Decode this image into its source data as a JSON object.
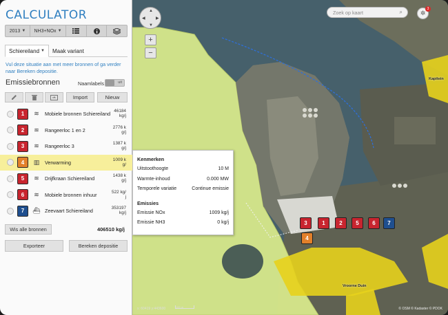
{
  "app": {
    "title": "CALCULATOR"
  },
  "toolbar": {
    "year": "2013",
    "substance": "NH3+NOx",
    "icons": [
      "list-icon",
      "info-icon",
      "layers-icon"
    ]
  },
  "tabs": [
    {
      "label": "Schiereiland",
      "active": true
    },
    {
      "label": "Maak variant",
      "active": false
    }
  ],
  "hint": "Vul deze situatie aan met meer bronnen of ga verder naar Bereken depositie.",
  "emission": {
    "title": "Emissiebronnen",
    "name_labels": "Naamlabels",
    "toggle_state": "uit"
  },
  "actions": {
    "icons": [
      "pencil-icon",
      "trash-icon",
      "copy-icon"
    ],
    "import": "Import",
    "new": "Nieuw"
  },
  "sources": [
    {
      "num": "1",
      "color": "#c8252f",
      "icon": "exhaust-icon",
      "glyph": "≋",
      "label": "Mobiele bronnen Schiereiland",
      "value": "46184 kg/j"
    },
    {
      "num": "2",
      "color": "#c8252f",
      "icon": "exhaust-icon",
      "glyph": "≋",
      "label": "Rangeerloc 1 en 2",
      "value": "2776 kg/j"
    },
    {
      "num": "3",
      "color": "#c8252f",
      "icon": "exhaust-icon",
      "glyph": "≋",
      "label": "Rangeerloc 3",
      "value": "1387 kg/j"
    },
    {
      "num": "4",
      "color": "#e2802a",
      "icon": "building-icon",
      "glyph": "▥",
      "label": "Verwarming",
      "value": "1009 kg/"
    },
    {
      "num": "5",
      "color": "#c8252f",
      "icon": "exhaust-icon",
      "glyph": "≋",
      "label": "Drijfkraan Schiereiland",
      "value": "1438 kg/j"
    },
    {
      "num": "6",
      "color": "#c8252f",
      "icon": "exhaust-icon",
      "glyph": "≋",
      "label": "Mobiele bronnen inhuur",
      "value": "522 kg/j"
    },
    {
      "num": "7",
      "color": "#1f4f8f",
      "icon": "ship-icon",
      "glyph": "⛴",
      "label": "Zeevaart Schiereiland",
      "value": "353197 kg/j"
    }
  ],
  "selected_index": 3,
  "footer": {
    "clear_all": "Wis alle bronnen",
    "total": "406510 kg/j",
    "export": "Exporteer",
    "calculate": "Bereken depositie"
  },
  "popup": {
    "section1": "Kenmerken",
    "rows1": [
      {
        "k": "Uitstoothoogte",
        "v": "10 M"
      },
      {
        "k": "Warmte-inhoud",
        "v": "0.000 MW"
      },
      {
        "k": "Temporele variatie",
        "v": "Continue emissie"
      }
    ],
    "section2": "Emissies",
    "rows2": [
      {
        "k": "Emissie NOx",
        "v": "1009 kg/j"
      },
      {
        "k": "Emissie NH3",
        "v": "0 kg/j"
      }
    ]
  },
  "map": {
    "search_placeholder": "Zoek op kaart",
    "notification_count": "3",
    "zoom_in": "+",
    "zoom_out": "−",
    "coords": "x: 60419 y:443600",
    "scale": "100 m",
    "credit": "© OSM © Kadaster © PDOK",
    "place_label": "Kapitein",
    "town_label": "Vroorne Duin",
    "markers": [
      {
        "num": "3",
        "color": "#c8252f"
      },
      {
        "num": "1",
        "color": "#c8252f"
      },
      {
        "num": "2",
        "color": "#c8252f"
      },
      {
        "num": "5",
        "color": "#c8252f"
      },
      {
        "num": "6",
        "color": "#c8252f"
      },
      {
        "num": "7",
        "color": "#1f4f8f"
      },
      {
        "num": "4",
        "color": "#e2802a"
      }
    ]
  },
  "colors": {
    "accent": "#2f7fc0",
    "nature_area": "#d7e88b",
    "zone_yellow": "#e7d11c",
    "selected_row": "#f7ef9b"
  }
}
